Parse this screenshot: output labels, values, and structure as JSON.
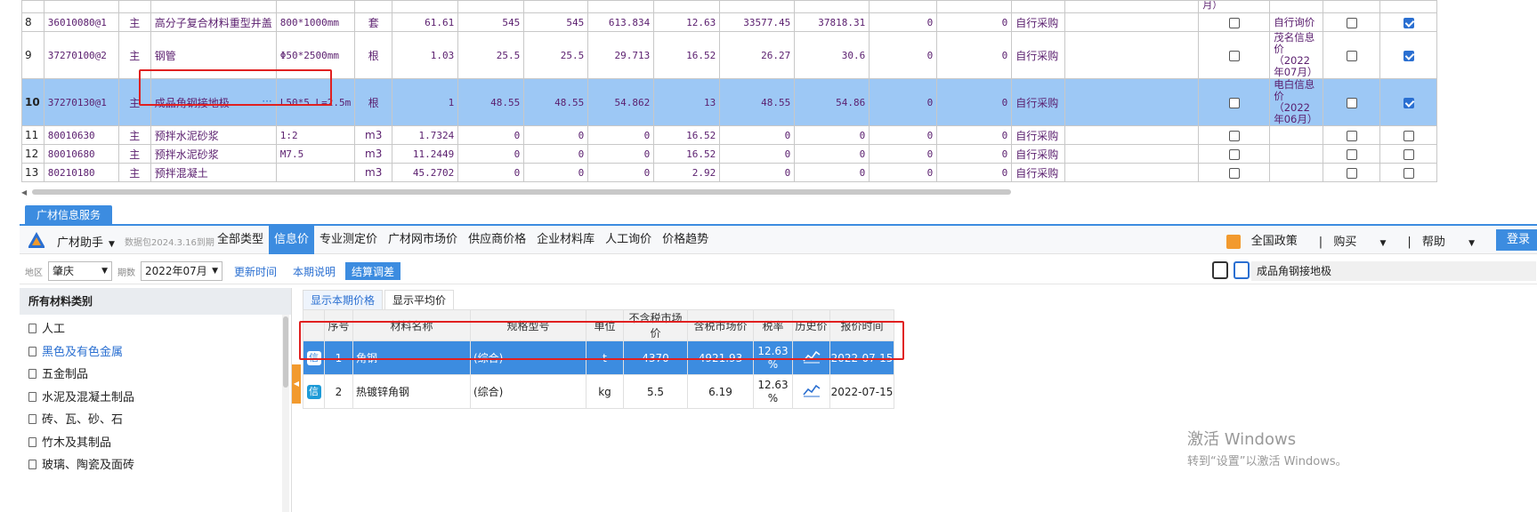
{
  "top_table": {
    "rows": [
      {
        "num": "8",
        "code": "36010080@1",
        "type": "主",
        "name": "高分子复合材料重型井盖",
        "spec": "800*1000mm",
        "unit": "套",
        "qty": "61.61",
        "v1": "545",
        "v2": "545",
        "v3": "613.834",
        "v4": "12.63",
        "v5": "33577.45",
        "v6": "37818.31",
        "v7": "0",
        "v8": "0",
        "source": "自行采购",
        "price_src": "自行询价",
        "checked": true,
        "selected": false
      },
      {
        "num": "9",
        "code": "37270100@2",
        "type": "主",
        "name": "钢管",
        "spec": "Φ50*2500mm",
        "unit": "根",
        "qty": "1.03",
        "v1": "25.5",
        "v2": "25.5",
        "v3": "29.713",
        "v4": "16.52",
        "v5": "26.27",
        "v6": "30.6",
        "v7": "0",
        "v8": "0",
        "source": "自行采购",
        "price_src": "茂名信息价（2022年07月）",
        "checked": true,
        "selected": false
      },
      {
        "num": "10",
        "code": "37270130@1",
        "type": "主",
        "name": "成品角钢接地极",
        "spec": "L50*5 L=2.5m",
        "unit": "根",
        "qty": "1",
        "v1": "48.55",
        "v2": "48.55",
        "v3": "54.862",
        "v4": "13",
        "v5": "48.55",
        "v6": "54.86",
        "v7": "0",
        "v8": "0",
        "source": "自行采购",
        "price_src": "电白信息价（2022年06月）",
        "checked": true,
        "selected": true
      },
      {
        "num": "11",
        "code": "80010630",
        "type": "主",
        "name": "预拌水泥砂浆",
        "spec": "1:2",
        "unit": "m3",
        "qty": "1.7324",
        "v1": "0",
        "v2": "0",
        "v3": "0",
        "v4": "16.52",
        "v5": "0",
        "v6": "0",
        "v7": "0",
        "v8": "0",
        "source": "自行采购",
        "price_src": "",
        "checked": false,
        "selected": false
      },
      {
        "num": "12",
        "code": "80010680",
        "type": "主",
        "name": "预拌水泥砂浆",
        "spec": "M7.5",
        "unit": "m3",
        "qty": "11.2449",
        "v1": "0",
        "v2": "0",
        "v3": "0",
        "v4": "16.52",
        "v5": "0",
        "v6": "0",
        "v7": "0",
        "v8": "0",
        "source": "自行采购",
        "price_src": "",
        "checked": false,
        "selected": false
      },
      {
        "num": "13",
        "code": "80210180",
        "type": "主",
        "name": "预拌混凝土",
        "spec": "",
        "unit": "m3",
        "qty": "45.2702",
        "v1": "0",
        "v2": "0",
        "v3": "0",
        "v4": "2.92",
        "v5": "0",
        "v6": "0",
        "v7": "0",
        "v8": "0",
        "source": "自行采购",
        "price_src": "",
        "checked": false,
        "selected": false
      }
    ],
    "top_partial_text_a": "月）",
    "top_partial_text_b": "月）",
    "ellipsis": "···"
  },
  "panel": {
    "tab_label": "广材信息服务",
    "brand": "广材助手",
    "package_info": "数据包2024.3.16到期",
    "nav_tabs": [
      "全部类型",
      "信息价",
      "专业测定价",
      "广材网市场价",
      "供应商价格",
      "企业材料库",
      "人工询价",
      "价格趋势"
    ],
    "active_nav": 1,
    "right_links": {
      "policy": "全国政策",
      "buy": "购买",
      "help": "帮助",
      "login": "登录"
    },
    "filters": {
      "region_label": "地区",
      "region_value": "肇庆",
      "period_label": "期数",
      "period_value": "2022年07月",
      "btn_update": "更新时间",
      "btn_desc": "本期说明",
      "btn_settle": "结算调差"
    },
    "search_value": "成品角钢接地极"
  },
  "sidebar": {
    "heading": "所有材料类别",
    "items": [
      "人工",
      "黑色及有色金属",
      "五金制品",
      "水泥及混凝土制品",
      "砖、瓦、砂、石",
      "竹木及其制品",
      "玻璃、陶瓷及面砖"
    ],
    "active_index": 1
  },
  "results": {
    "subtabs": [
      "显示本期价格",
      "显示平均价"
    ],
    "headers": [
      "序号",
      "材料名称",
      "规格型号",
      "单位",
      "不含税市场价",
      "含税市场价",
      "税率",
      "历史价",
      "报价时间"
    ],
    "badge": "信",
    "rows": [
      {
        "seq": "1",
        "name": "角钢",
        "spec": "(综合)",
        "unit": "t",
        "price_ex": "4370",
        "price_in": "4921.93",
        "tax_a": "12.63",
        "tax_b": "%",
        "date": "2022-07-15",
        "selected": true
      },
      {
        "seq": "2",
        "name": "热镀锌角钢",
        "spec": "(综合)",
        "unit": "kg",
        "price_ex": "5.5",
        "price_in": "6.19",
        "tax_a": "12.63",
        "tax_b": "%",
        "date": "2022-07-15",
        "selected": false
      }
    ]
  },
  "watermark": {
    "line1": "激活 Windows",
    "line2": "转到“设置”以激活 Windows。"
  },
  "colors": {
    "accent": "#3c8ce0",
    "highlight_row": "#9dc8f5",
    "red_box": "#e02020",
    "text_purple": "#5a1e6e"
  }
}
